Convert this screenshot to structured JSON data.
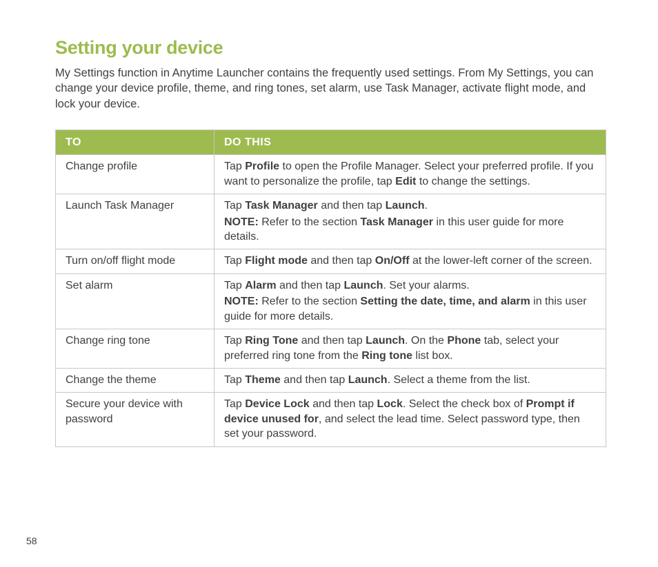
{
  "page": {
    "title": "Setting your device",
    "intro": "My Settings function in Anytime Launcher contains the frequently used settings. From My Settings, you can change your device profile, theme, and ring tones, set alarm, use Task Manager, activate flight mode, and lock your device.",
    "number": "58"
  },
  "table": {
    "headers": {
      "col1": "TO",
      "col2": "DO THIS"
    },
    "rows": [
      {
        "to": "Change profile",
        "tap_prefix": "Tap ",
        "tap_bold1": "Profile",
        "tap_mid": " to open the Profile Manager. Select your preferred profile. If you want to personalize the profile, tap ",
        "tap_bold2": "Edit",
        "tap_suffix": " to change the settings."
      },
      {
        "to": "Launch Task Manager",
        "tap_prefix": "Tap ",
        "tap_bold1": "Task Manager",
        "tap_mid": " and then tap ",
        "tap_bold2": "Launch",
        "tap_suffix": ".",
        "note_label": "NOTE:",
        "note_prefix": " Refer to the section ",
        "note_bold": "Task Manager",
        "note_suffix": " in this user guide for more details."
      },
      {
        "to": "Turn on/off flight mode",
        "tap_prefix": "Tap ",
        "tap_bold1": "Flight mode",
        "tap_mid": " and then tap ",
        "tap_bold2": "On/Off",
        "tap_suffix": " at the lower-left corner of the screen."
      },
      {
        "to": "Set alarm",
        "tap_prefix": "Tap ",
        "tap_bold1": "Alarm",
        "tap_mid": " and then tap ",
        "tap_bold2": "Launch",
        "tap_suffix": ". Set your alarms.",
        "note_label": "NOTE:",
        "note_prefix": " Refer to the section ",
        "note_bold": "Setting the date, time, and alarm",
        "note_suffix": " in this user guide for more details."
      },
      {
        "to": "Change ring tone",
        "tap_prefix": "Tap ",
        "tap_bold1": "Ring Tone",
        "tap_mid": " and then tap ",
        "tap_bold2": "Launch",
        "tap_mid2": ". On the ",
        "tap_bold3": "Phone",
        "tap_mid3": " tab, select your preferred ring tone from the ",
        "tap_bold4": "Ring tone",
        "tap_suffix": " list box."
      },
      {
        "to": "Change the theme",
        "tap_prefix": "Tap ",
        "tap_bold1": "Theme",
        "tap_mid": " and then tap ",
        "tap_bold2": "Launch",
        "tap_suffix": ". Select a theme from the list."
      },
      {
        "to": "Secure your device with password",
        "tap_prefix": "Tap ",
        "tap_bold1": "Device Lock",
        "tap_mid": " and then tap ",
        "tap_bold2": "Lock",
        "tap_mid2": ". Select the check box of ",
        "tap_bold3": "Prompt if device unused for",
        "tap_suffix": ", and select the lead time. Select password type, then set your password."
      }
    ]
  }
}
